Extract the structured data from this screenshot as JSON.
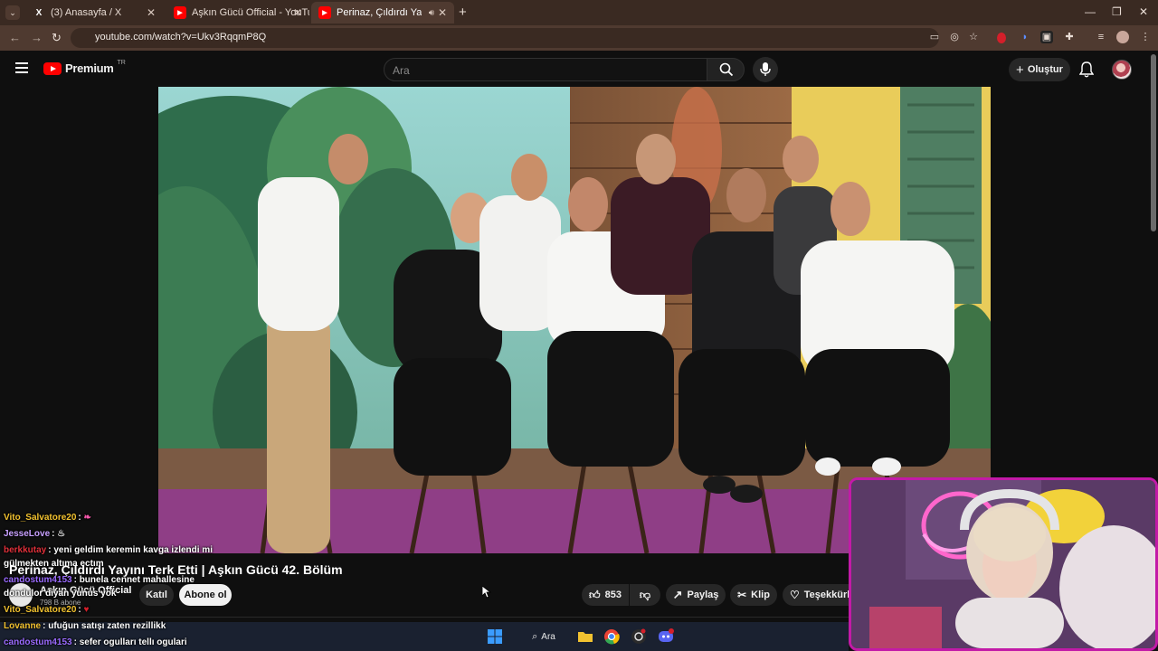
{
  "browser": {
    "tabs": [
      {
        "label": "(3) Anasayfa / X",
        "favicon": "X"
      },
      {
        "label": "Aşkın Gücü Official - YouTube",
        "favicon": "▶"
      },
      {
        "label": "Perinaz, Çıldırdı Yayını Terk",
        "favicon": "▶"
      }
    ],
    "url": "youtube.com/watch?v=Ukv3RqqmP8Q"
  },
  "youtube": {
    "logo_text": "Premium",
    "logo_region": "TR",
    "search_placeholder": "Ara",
    "create_label": "Oluştur"
  },
  "video": {
    "title": "Perinaz, Çıldırdı Yayını Terk Etti | Aşkın Gücü 42. Bölüm",
    "channel_name": "Aşkın Gücü Official",
    "subscribers": "798 B abone",
    "join_label": "Katıl",
    "subscribe_label": "Abone ol",
    "likes": "853",
    "share_label": "Paylaş",
    "clip_label": "Klip",
    "thanks_label": "Teşekkürle"
  },
  "chat": [
    {
      "user": "Vito_Salvatore20",
      "text": "",
      "color": "#f2c230"
    },
    {
      "user": "JesseLove",
      "text": "",
      "color": "#c8a0ff"
    },
    {
      "user": "berkkutay",
      "text": "yeni geldim keremin kavga izlendi mi",
      "color": "#e0303a"
    },
    {
      "user": "",
      "text": "gülmekten altıma ectım",
      "color": "#ffffff"
    },
    {
      "user": "candostum4153",
      "text": "bunela cennet mahallesine",
      "color": "#9b6bff"
    },
    {
      "user": "",
      "text": "dondulor diyan yunus yok",
      "color": "#ffffff"
    },
    {
      "user": "Vito_Salvatore20",
      "text": "",
      "color": "#f2c230"
    },
    {
      "user": "Lovanne",
      "text": "ufuğun satışı zaten rezillikk",
      "color": "#f2c230"
    },
    {
      "user": "candostum4153",
      "text": "sefer ogulları tellı ogulari",
      "color": "#9b6bff"
    }
  ],
  "taskbar": {
    "search_label": "Ara"
  },
  "icons": [
    "menu-icon",
    "youtube-logo",
    "search-icon",
    "mic-icon",
    "plus-icon",
    "bell-icon",
    "like-icon",
    "dislike-icon",
    "share-icon",
    "scissors-icon",
    "heart-dollar-icon",
    "windows-icon",
    "folder-icon",
    "chrome-icon",
    "discord-icon"
  ],
  "colors": {
    "youtube_red": "#ff0000",
    "stream_border": "#c21aa7"
  }
}
